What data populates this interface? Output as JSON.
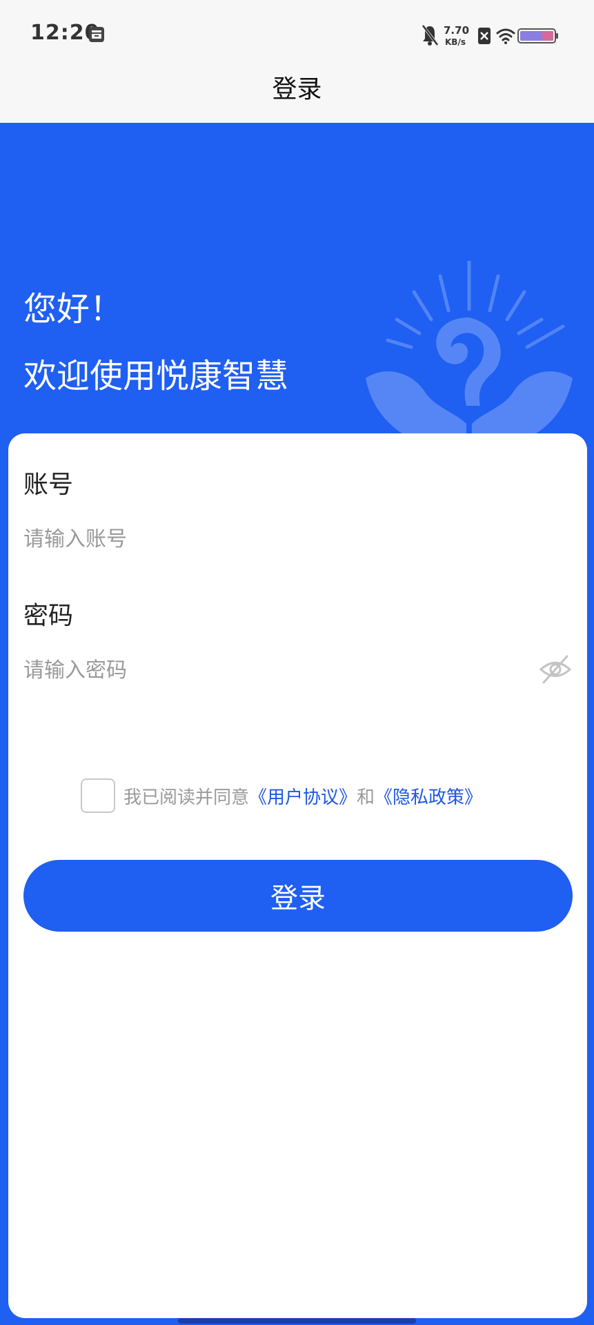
{
  "status_bar": {
    "time": "12:20",
    "net_speed_value": "7.70",
    "net_speed_unit": "KB/s",
    "icons": [
      "mute-icon",
      "sim-off-icon",
      "wifi-icon",
      "battery-icon"
    ]
  },
  "nav": {
    "title": "登录"
  },
  "hero": {
    "greeting": "您好！",
    "welcome": "欢迎使用悦康智慧"
  },
  "form": {
    "account_label": "账号",
    "account_placeholder": "请输入账号",
    "password_label": "密码",
    "password_placeholder": "请输入密码"
  },
  "agreement": {
    "prefix": "我已阅读并同意",
    "user_agreement": "《用户协议》",
    "conjunction": "和",
    "privacy_policy": "《隐私政策》",
    "checked": false
  },
  "login_button": "登录",
  "colors": {
    "primary": "#1f5ff2",
    "link": "#1e56e0",
    "placeholder": "#999999"
  }
}
